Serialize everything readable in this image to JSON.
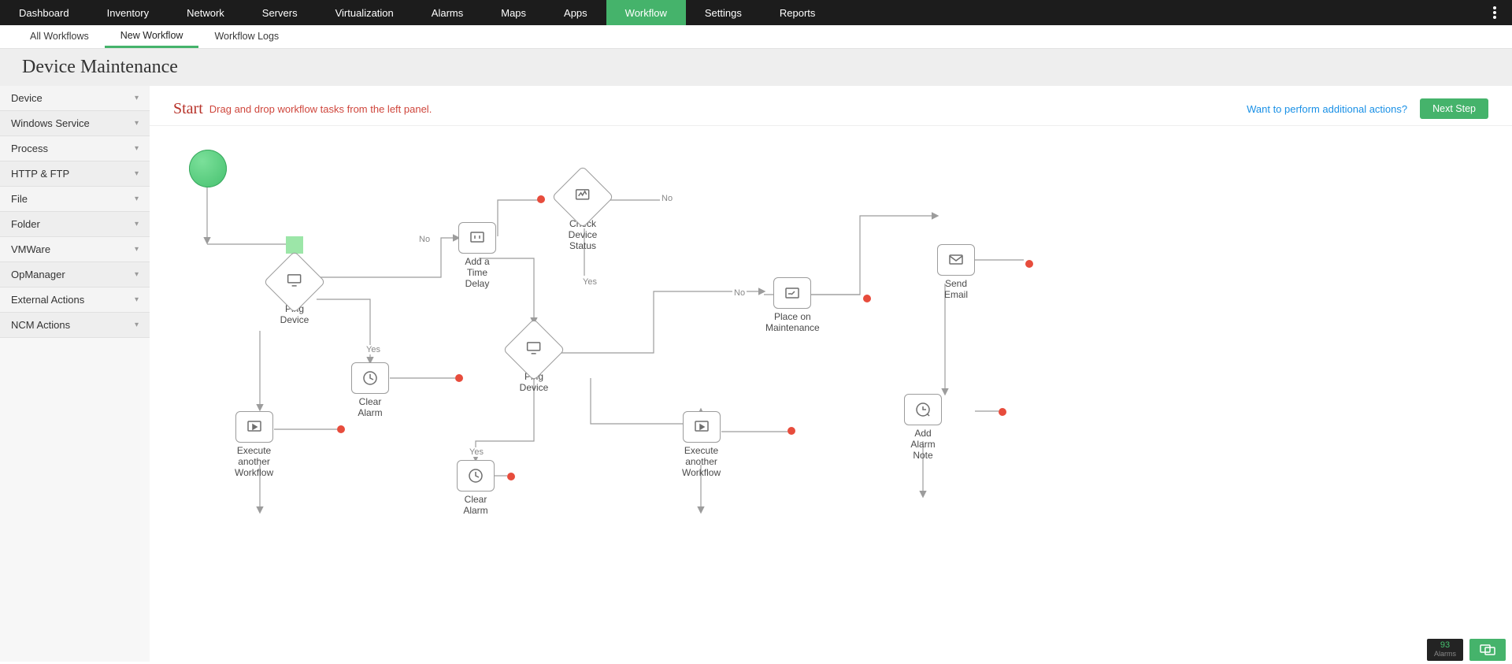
{
  "topnav": {
    "items": [
      "Dashboard",
      "Inventory",
      "Network",
      "Servers",
      "Virtualization",
      "Alarms",
      "Maps",
      "Apps",
      "Workflow",
      "Settings",
      "Reports"
    ],
    "active": "Workflow"
  },
  "subtabs": {
    "items": [
      "All Workflows",
      "New Workflow",
      "Workflow Logs"
    ],
    "active": "New Workflow"
  },
  "page_title": "Device Maintenance",
  "sidebar": {
    "categories": [
      "Device",
      "Windows Service",
      "Process",
      "HTTP & FTP",
      "File",
      "Folder",
      "VMWare",
      "OpManager",
      "External Actions",
      "NCM Actions"
    ]
  },
  "canvas_header": {
    "start": "Start",
    "hint": "Drag and drop workflow tasks from the left panel.",
    "help_link": "Want to perform additional actions?",
    "next_button": "Next Step"
  },
  "nodes": {
    "ping1": "Ping\nDevice",
    "clear1": "Clear\nAlarm",
    "exec1": "Execute\nanother\nWorkflow",
    "delay": "Add a\nTime\nDelay",
    "ping2": "Ping\nDevice",
    "clear2": "Clear\nAlarm",
    "check": "Check\nDevice\nStatus",
    "maint": "Place on\nMaintenance",
    "exec2": "Execute\nanother\nWorkflow",
    "email": "Send\nEmail",
    "addnote": "Add\nAlarm\nNote"
  },
  "edge_labels": {
    "no1": "No",
    "yes1": "Yes",
    "no2": "No",
    "yes2": "Yes",
    "no3": "No",
    "yes3": "Yes"
  },
  "status": {
    "alarms_count": "93",
    "alarms_label": "Alarms"
  }
}
